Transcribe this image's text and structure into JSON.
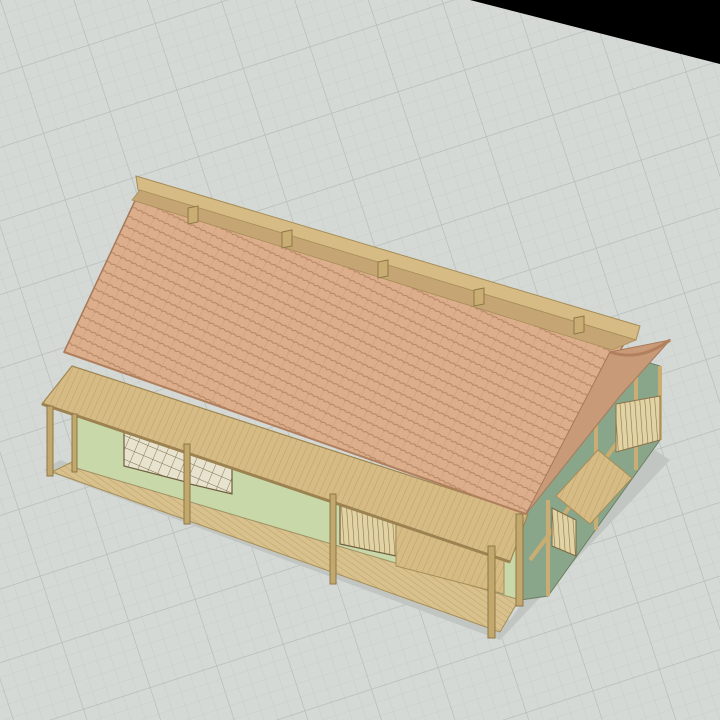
{
  "viewport": {
    "background": "#d5d9d5",
    "grid_minor_color": "#c6cbc7",
    "grid_major_color": "#b4bab5",
    "void_color": "#000000"
  },
  "model": {
    "roof_tile_color": "#dcae8b",
    "roof_tile_line_color": "#b48462",
    "wood_color": "#d6bc84",
    "wood_dark_color": "#b39a62",
    "wall_panel_color": "#c8d8a8",
    "wall_green_color": "#8aa68a",
    "shoji_color": "#e7e3cf",
    "shadow_color": "#bdc0bc"
  }
}
